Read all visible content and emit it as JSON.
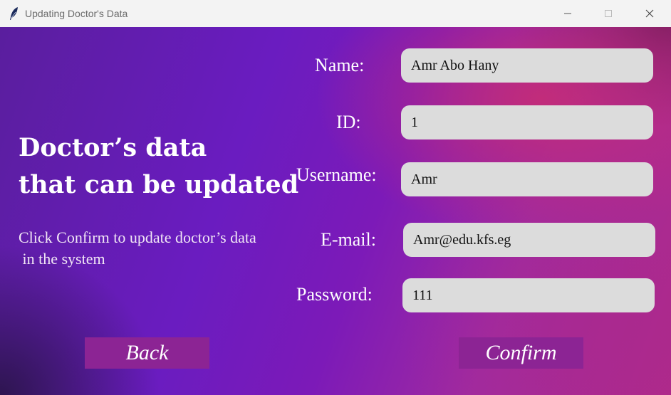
{
  "window": {
    "title": "Updating Doctor's Data",
    "icon": "feather-icon",
    "controls": [
      "minimize-icon",
      "maximize-icon",
      "close-icon"
    ]
  },
  "heading": {
    "line1": "Doctor’s data",
    "line2": "that can be updated"
  },
  "description": "Click Confirm to update doctor’s data\n in the system",
  "form": {
    "name": {
      "label": "Name:",
      "value": "Amr Abo Hany"
    },
    "id": {
      "label": "ID:",
      "value": "1"
    },
    "username": {
      "label": "Username:",
      "value": "Amr"
    },
    "email": {
      "label": "E-mail:",
      "value": "Amr@edu.kfs.eg"
    },
    "password": {
      "label": "Password:",
      "value": "111"
    }
  },
  "buttons": {
    "back": "Back",
    "confirm": "Confirm"
  },
  "colors": {
    "button_bg": "#8c2494",
    "field_bg": "#dcdcdc",
    "gradient_purple": "#6a1cc0",
    "gradient_pink": "#c42c78"
  }
}
